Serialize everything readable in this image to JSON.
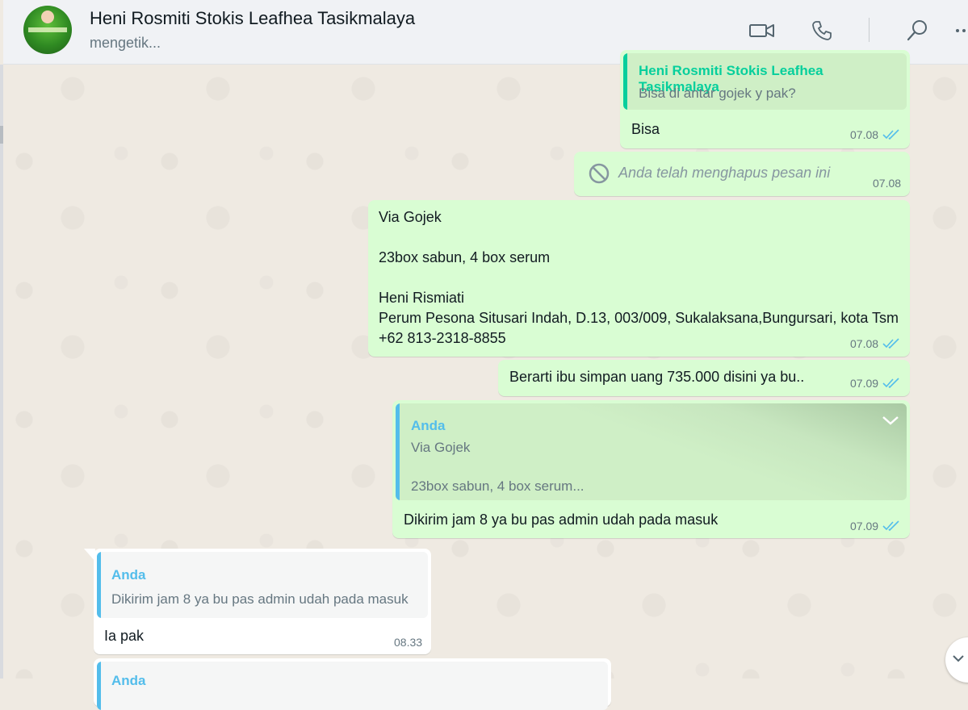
{
  "header": {
    "contact_name": "Heni Rosmiti Stokis Leafhea Tasikmalaya",
    "status": "mengetik...",
    "icons": [
      "video-call-icon",
      "voice-call-icon",
      "search-icon",
      "menu-icon"
    ]
  },
  "colors": {
    "outgoing_bubble": "#d9fdd3",
    "incoming_bubble": "#ffffff",
    "quote_author_green": "#06cf9c",
    "quote_author_blue": "#53bdeb",
    "read_ticks": "#53bdeb"
  },
  "messages": [
    {
      "quote_author": "Heni Rosmiti Stokis Leafhea Tasikmalaya",
      "quote_text": "Bisa di antar gojek y pak?",
      "text": "Bisa",
      "time": "07.08"
    },
    {
      "deleted_text": "Anda telah menghapus pesan ini",
      "time": "07.08"
    },
    {
      "text": "Via Gojek\n\n23box sabun, 4 box serum\n\nHeni Rismiati\nPerum Pesona Situsari Indah, D.13, 003/009, Sukalaksana,Bungursari, kota Tsm\n+62 813-2318-8855",
      "time": "07.08"
    },
    {
      "text": "Berarti ibu simpan uang 735.000 disini ya bu..",
      "time": "07.09"
    },
    {
      "quote_author": "Anda",
      "quote_text": "Via Gojek\n\n23box sabun, 4 box serum...",
      "text": "Dikirim jam 8 ya bu pas admin udah pada masuk",
      "time": "07.09"
    },
    {
      "quote_author": "Anda",
      "quote_text": "Dikirim jam 8 ya bu pas admin udah pada masuk",
      "text": "Ia pak",
      "time": "08.33"
    },
    {
      "quote_author": "Anda"
    }
  ]
}
